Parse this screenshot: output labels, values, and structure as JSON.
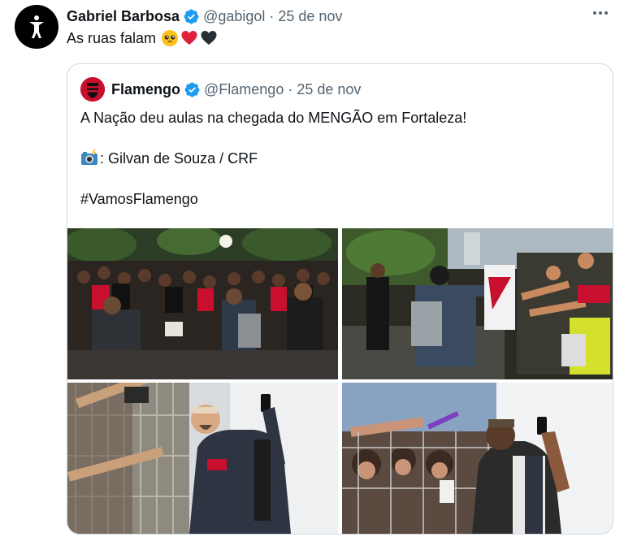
{
  "tweet": {
    "author_name": "Gabriel Barbosa",
    "handle": "@gabigol",
    "separator": "·",
    "date": "25 de nov",
    "text": "As ruas falam",
    "emojis": [
      "pleading-face",
      "red-heart",
      "black-heart"
    ]
  },
  "quote": {
    "author_name": "Flamengo",
    "handle": "@Flamengo",
    "separator": "·",
    "date": "25 de nov",
    "line1": "A Nação deu aulas na chegada do MENGÃO em Fortaleza!",
    "credit": ": Gilvan de Souza / CRF",
    "hashtag": "#VamosFlamengo",
    "photos": [
      "photo-crowd-night",
      "photo-player-signing-shirts",
      "photo-player-selfie",
      "photo-fans-at-fence"
    ]
  },
  "colors": {
    "verified": "#1d9bf0",
    "text": "#0f1419",
    "secondary": "#536471",
    "border": "#cfd9de",
    "flamengo_red": "#c8102e"
  }
}
